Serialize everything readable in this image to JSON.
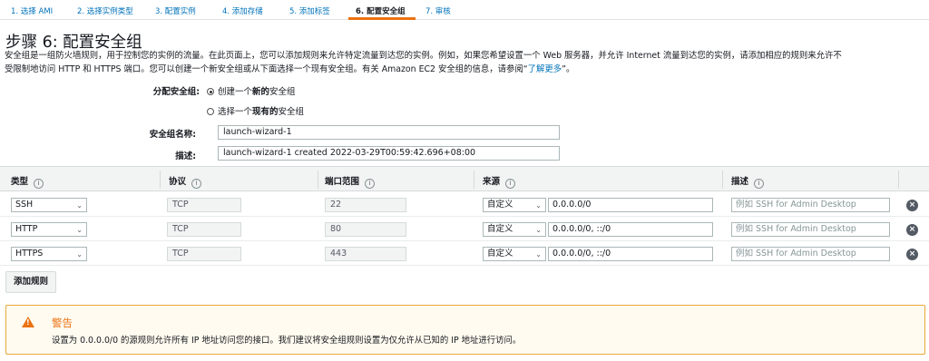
{
  "steps": [
    {
      "label": "1. 选择 AMI"
    },
    {
      "label": "2. 选择实例类型"
    },
    {
      "label": "3. 配置实例"
    },
    {
      "label": "4. 添加存储"
    },
    {
      "label": "5. 添加标签"
    },
    {
      "label": "6. 配置安全组"
    },
    {
      "label": "7. 审核"
    }
  ],
  "active_step": 6,
  "colors": {
    "accent": "#ec7211",
    "link": "#0073bb",
    "text": "#16191f"
  },
  "page": {
    "title": "步骤 6: 配置安全组",
    "desc_line1": "安全组是一组防火墙规则，用于控制您的实例的流量。在此页面上，您可以添加规则来允许特定流量到达您的实例。例如，如果您希望设置一个 Web 服务器，并允许 Internet 流量到达您的实例，请添加相应的规则来允许不",
    "desc_line2": "受限制地访问 HTTP 和 HTTPS 端口。您可以创建一个新安全组或从下面选择一个现有安全组。有关 Amazon EC2 安全组的信息，请参阅“",
    "desc_link": "了解更多",
    "desc_end": "”。"
  },
  "form": {
    "assign_label": "分配安全组:",
    "option_new": {
      "prefix": "创建一个",
      "bold": "新的",
      "suffix": "安全组",
      "selected": true
    },
    "option_existing": {
      "prefix": "选择一个",
      "bold": "现有的",
      "suffix": "安全组",
      "selected": false
    },
    "name_label": "安全组名称:",
    "name_value": "launch-wizard-1",
    "desc_label": "描述:",
    "desc_value": "launch-wizard-1 created 2022-03-29T00:59:42.696+08:00"
  },
  "table": {
    "headers": {
      "type": "类型",
      "protocol": "协议",
      "port": "端口范围",
      "source": "来源",
      "description": "描述"
    },
    "info_icon": "i",
    "rows": [
      {
        "type": "SSH",
        "protocol": "TCP",
        "port": "22",
        "source_type": "自定义",
        "source": "0.0.0.0/0",
        "desc_placeholder": "例如 SSH for Admin Desktop"
      },
      {
        "type": "HTTP",
        "protocol": "TCP",
        "port": "80",
        "source_type": "自定义",
        "source": "0.0.0.0/0, ::/0",
        "desc_placeholder": "例如 SSH for Admin Desktop"
      },
      {
        "type": "HTTPS",
        "protocol": "TCP",
        "port": "443",
        "source_type": "自定义",
        "source": "0.0.0.0/0, ::/0",
        "desc_placeholder": "例如 SSH for Admin Desktop"
      }
    ]
  },
  "add_rule_label": "添加规则",
  "warning": {
    "title": "警告",
    "text": "设置为 0.0.0.0/0 的源规则允许所有 IP 地址访问您的接口。我们建议将安全组规则设置为仅允许从已知的 IP 地址进行访问。"
  }
}
